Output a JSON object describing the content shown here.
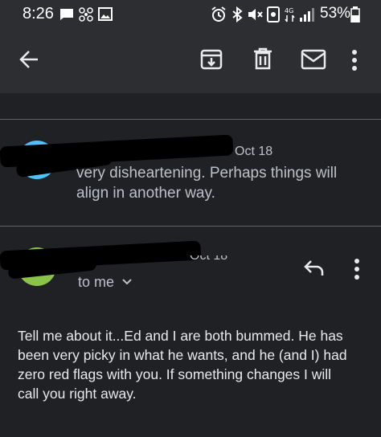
{
  "status_bar": {
    "time": "8:26",
    "battery": "53%",
    "icons": [
      "message-icon",
      "pinwheel-icon",
      "image-icon",
      "alarm-icon",
      "bluetooth-icon",
      "mute-icon",
      "nfc-icon",
      "data-icon",
      "signal-icon",
      "battery-icon"
    ]
  },
  "toolbar": {
    "icons": [
      "back-arrow-icon",
      "archive-icon",
      "delete-icon",
      "mail-icon",
      "more-vert-icon"
    ]
  },
  "messages": [
    {
      "date": "Oct 18",
      "snippet_line1": "very disheartening. Perhaps things will",
      "snippet_line2": "align in another way.",
      "avatar_color": "#4fc3f7"
    },
    {
      "date": "Oct 18",
      "recipient": "to me",
      "avatar_color": "#8bc34a",
      "body_lines": [
        "Tell me about it...Ed and I are both bummed.  He has",
        "been very picky in what he wants, and he (and I) had",
        "zero red flags with you.  If something changes I will",
        "call you right away."
      ]
    }
  ],
  "colors": {
    "background": "#202124",
    "toolbar": "#2d2e31",
    "text_primary": "#e8eaed",
    "text_secondary": "#bdc1c6"
  }
}
